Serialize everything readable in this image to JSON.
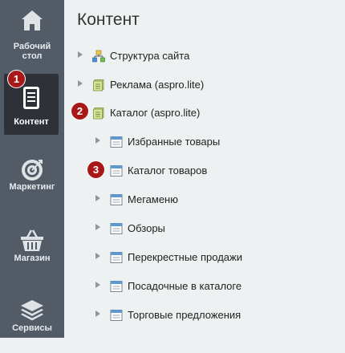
{
  "sidebar": {
    "items": [
      {
        "label_line1": "Рабочий",
        "label_line2": "стол",
        "icon": "home-icon"
      },
      {
        "label": "Контент",
        "icon": "document-icon",
        "active": true
      },
      {
        "label": "Маркетинг",
        "icon": "target-icon"
      },
      {
        "label": "Магазин",
        "icon": "basket-icon"
      },
      {
        "label": "Сервисы",
        "icon": "layers-icon"
      }
    ]
  },
  "badges": [
    "1",
    "2",
    "3"
  ],
  "main": {
    "title": "Контент",
    "tree": [
      {
        "label": "Структура сайта",
        "icon": "site-structure-icon"
      },
      {
        "label": "Реклама (aspro.lite)",
        "icon": "iblock-type-icon"
      },
      {
        "label": "Каталог (aspro.lite)",
        "icon": "iblock-type-icon"
      },
      {
        "label": "Избранные товары",
        "icon": "iblock-icon"
      },
      {
        "label": "Каталог товаров",
        "icon": "iblock-icon"
      },
      {
        "label": "Мегаменю",
        "icon": "iblock-icon"
      },
      {
        "label": "Обзоры",
        "icon": "iblock-icon"
      },
      {
        "label": "Перекрестные продажи",
        "icon": "iblock-icon"
      },
      {
        "label": "Посадочные в каталоге",
        "icon": "iblock-icon"
      },
      {
        "label": "Торговые предложения",
        "icon": "iblock-icon"
      }
    ]
  },
  "colors": {
    "sidebar": "#525b66",
    "active": "#2e3238",
    "badge": "#a91818",
    "background": "#eef1f2"
  }
}
